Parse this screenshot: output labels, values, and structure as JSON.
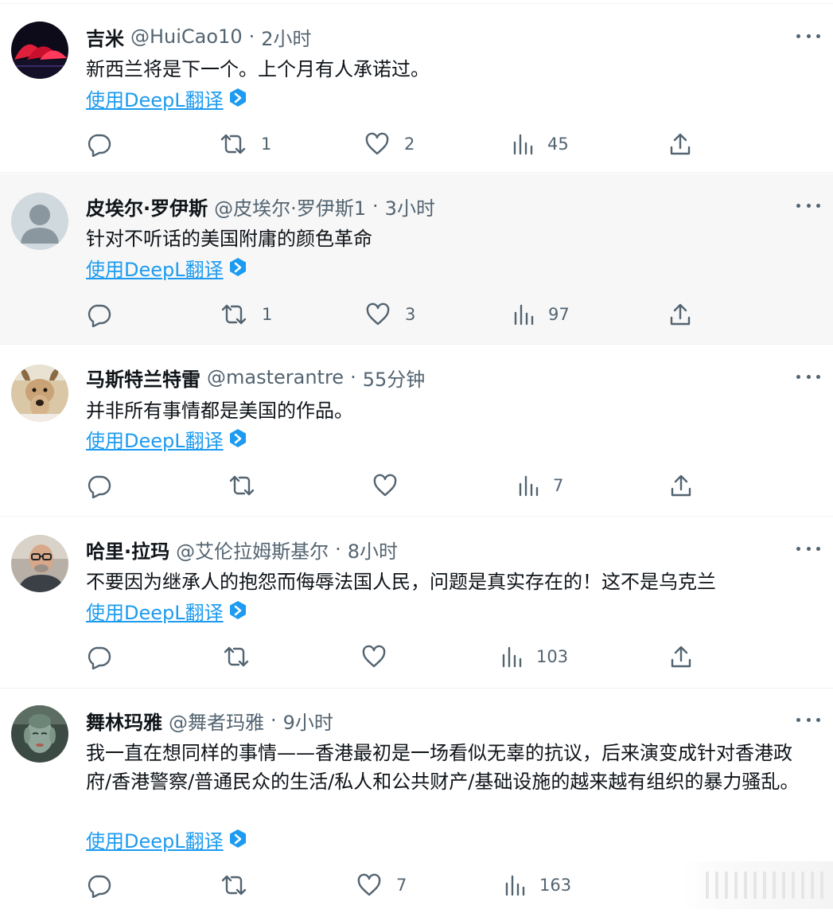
{
  "tweets": [
    {
      "name": "吉米",
      "handle": "@HuiCao10",
      "time": "2小时",
      "text": "新西兰将是下一个。上个月有人承诺过。",
      "translate": "使用DeepL翻译",
      "reposts": "1",
      "likes": "2",
      "views": "45",
      "avatar": "opera-house-at-night"
    },
    {
      "name": "皮埃尔·罗伊斯",
      "handle": "@皮埃尔·罗伊斯1",
      "time": "3小时",
      "text": "针对不听话的美国附庸的颜色革命",
      "translate": "使用DeepL翻译",
      "reposts": "1",
      "likes": "3",
      "views": "97",
      "avatar": "default-silhouette"
    },
    {
      "name": "马斯特兰特雷",
      "handle": "@masterantre",
      "time": "55分钟",
      "text": "并非所有事情都是美国的作品。",
      "translate": "使用DeepL翻译",
      "reposts": "",
      "likes": "",
      "views": "7",
      "avatar": "dog-photo"
    },
    {
      "name": "哈里·拉玛",
      "handle": "@艾伦拉姆斯基尔",
      "time": "8小时",
      "text": "不要因为继承人的抱怨而侮辱法国人民，问题是真实存在的！这不是乌克兰",
      "translate": "使用DeepL翻译",
      "reposts": "",
      "likes": "",
      "views": "103",
      "avatar": "man-with-glasses"
    },
    {
      "name": "舞林玛雅",
      "handle": "@舞者玛雅",
      "time": "9小时",
      "text": "我一直在想同样的事情——香港最初是一场看似无辜的抗议，后来演变成针对香港政府/香港警察/普通民众的生活/私人和公共财产/基础设施的越来越有组织的暴力骚乱。",
      "translate": "使用DeepL翻译",
      "reposts": "",
      "likes": "7",
      "views": "163",
      "avatar": "buddha-statue"
    }
  ],
  "icons": {
    "reply": "speech-bubble-icon",
    "repost": "repost-arrows-icon",
    "like": "heart-icon",
    "views": "bar-chart-icon",
    "share": "share-upload-icon",
    "more": "more-dots-icon",
    "badge": "deepl-badge-icon"
  },
  "colors": {
    "link": "#1d9bf0",
    "muted": "#536471",
    "highlight_bg": "#f7f7f7",
    "text": "#0f1419"
  }
}
